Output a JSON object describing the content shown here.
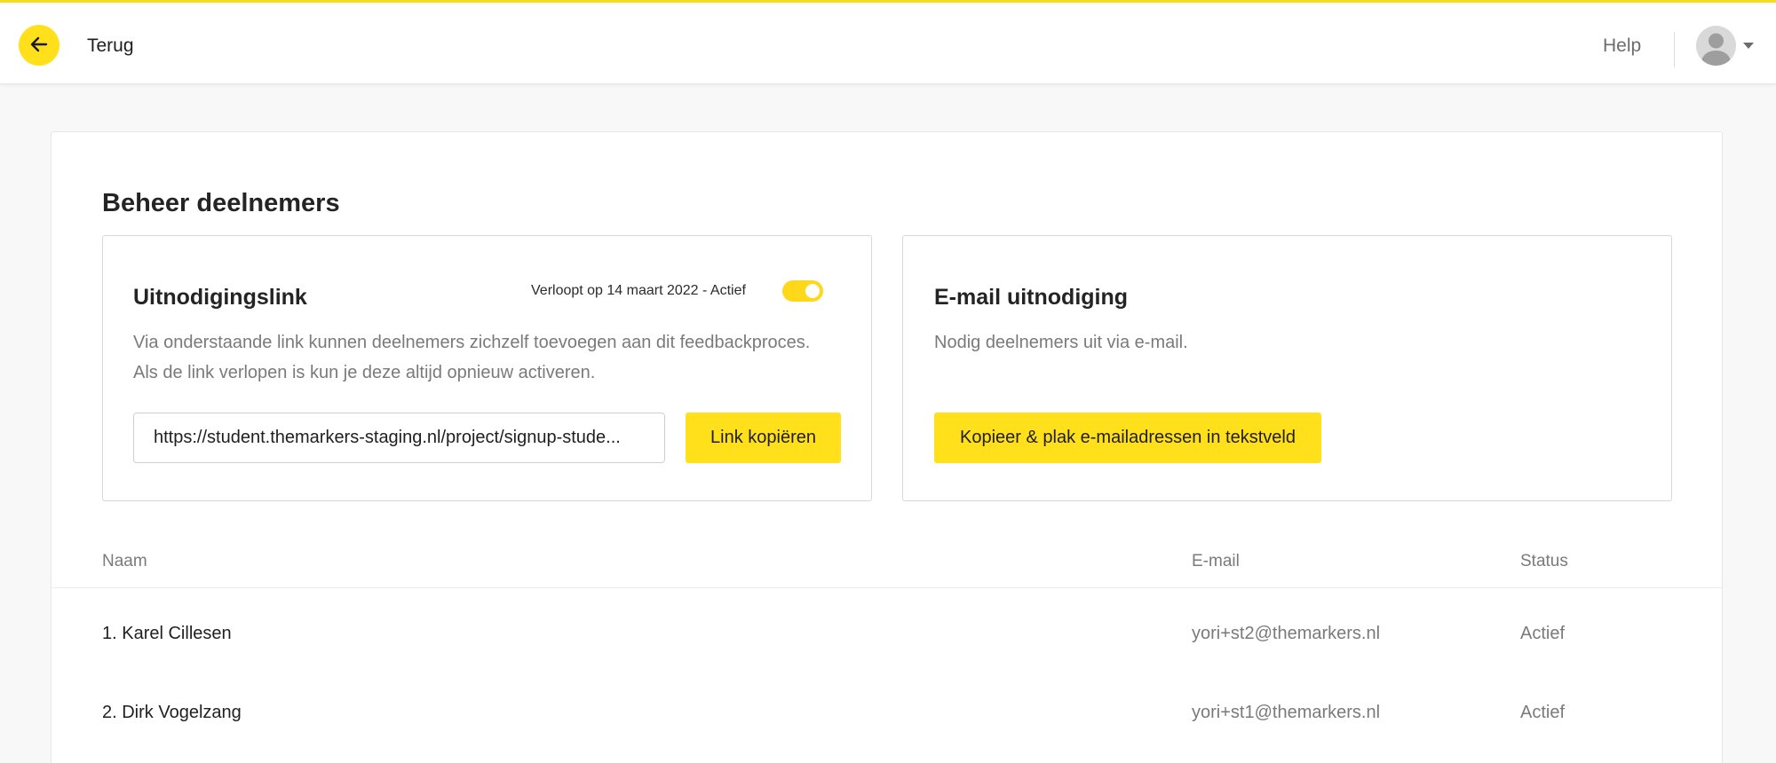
{
  "colors": {
    "accent": "#ffe01b",
    "toggle_on": "#ffd81a",
    "muted_text": "#7a7a7a"
  },
  "header": {
    "back_icon": "arrow-left-icon",
    "back_label": "Terug",
    "help_label": "Help",
    "avatar_icon": "user-avatar-icon",
    "menu_icon": "chevron-down-icon"
  },
  "page": {
    "title": "Beheer deelnemers"
  },
  "invite_link": {
    "title": "Uitnodigingslink",
    "expiry_text": "Verloopt op 14 maart 2022 - Actief",
    "toggle_on": true,
    "description_line1": "Via onderstaande link kunnen deelnemers zichzelf toevoegen aan dit feedbackproces.",
    "description_line2": "Als de link verlopen is kun je deze altijd opnieuw activeren.",
    "url_value": "https://student.themarkers-staging.nl/project/signup-stude...",
    "copy_button": "Link kopiëren"
  },
  "email_invite": {
    "title": "E-mail uitnodiging",
    "description": "Nodig deelnemers uit via e-mail.",
    "paste_button": "Kopieer & plak e-mailadressen in tekstveld"
  },
  "table": {
    "columns": {
      "name": "Naam",
      "email": "E-mail",
      "status": "Status"
    },
    "rows": [
      {
        "name": "1. Karel Cillesen",
        "email": "yori+st2@themarkers.nl",
        "status": "Actief"
      },
      {
        "name": "2. Dirk Vogelzang",
        "email": "yori+st1@themarkers.nl",
        "status": "Actief"
      }
    ]
  }
}
